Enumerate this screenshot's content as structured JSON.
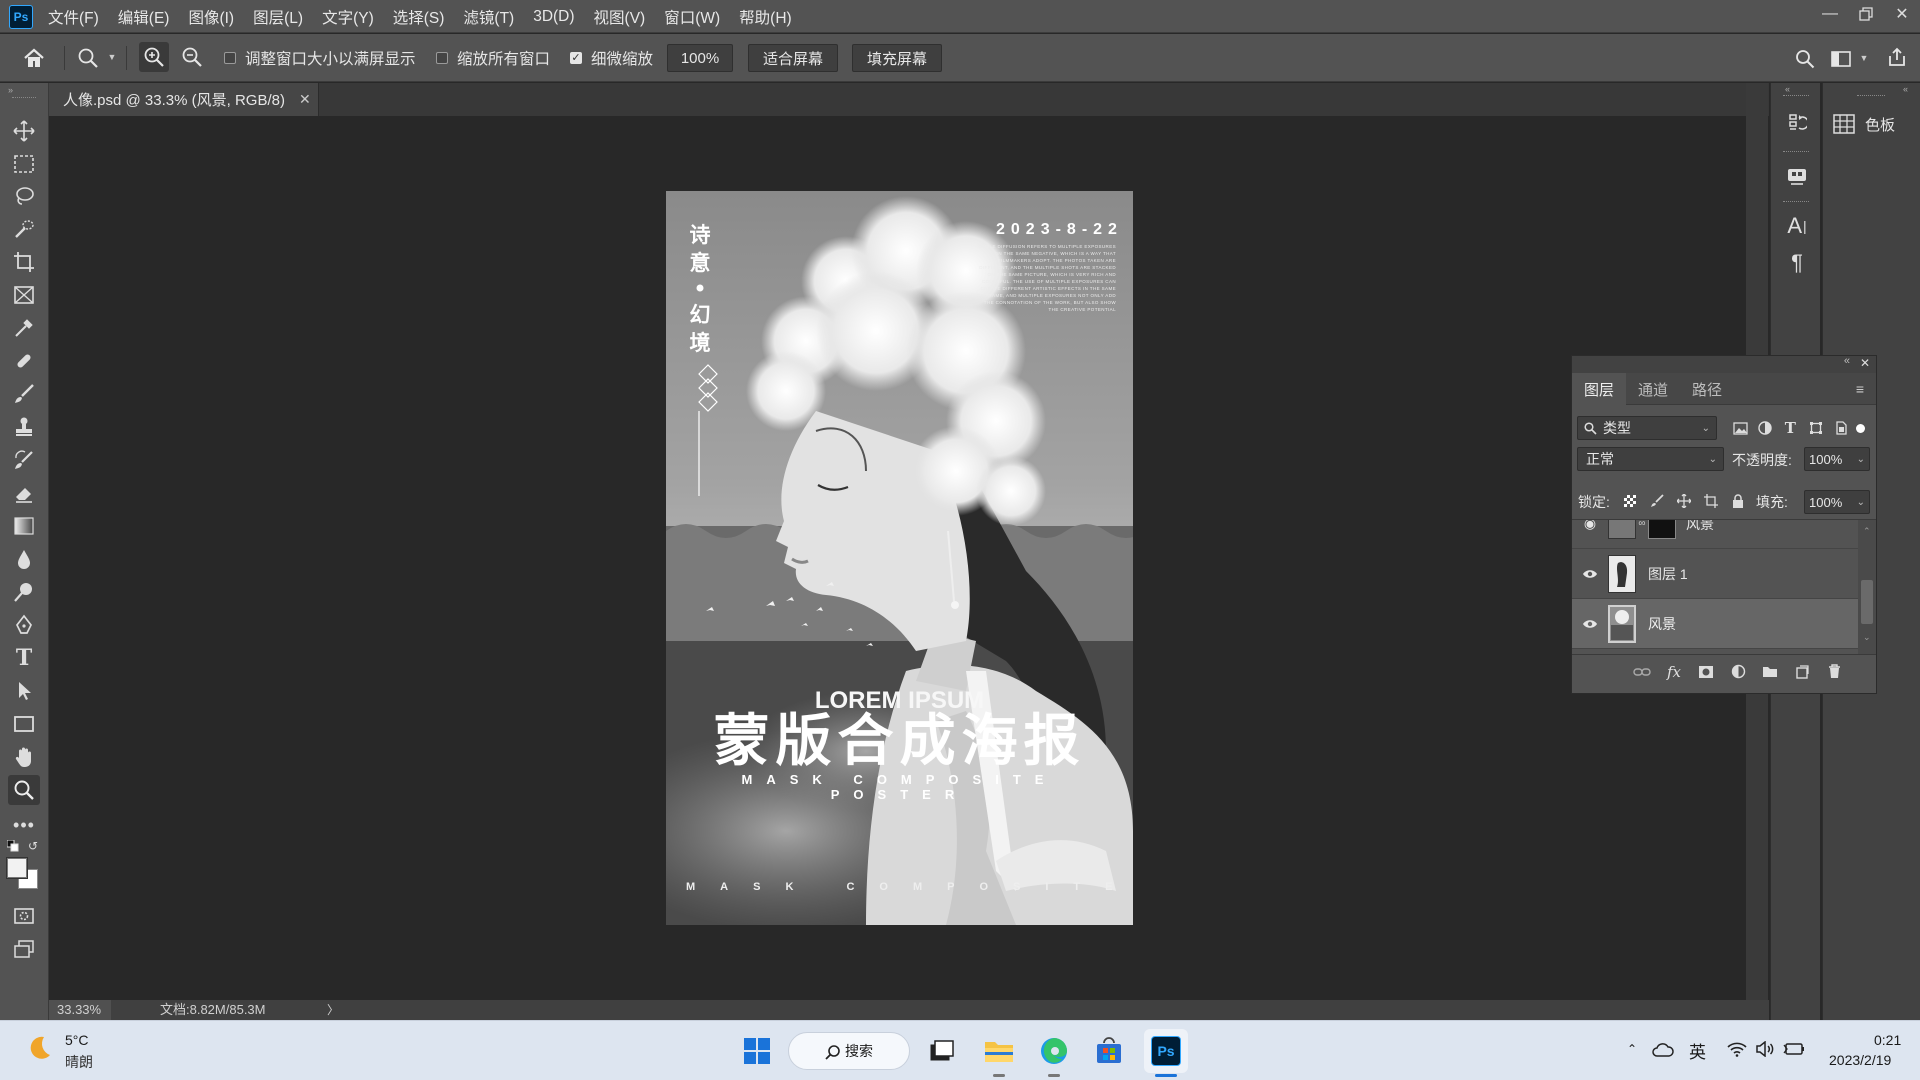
{
  "app": {
    "logo_text": "Ps"
  },
  "menu": [
    "文件(F)",
    "编辑(E)",
    "图像(I)",
    "图层(L)",
    "文字(Y)",
    "选择(S)",
    "滤镜(T)",
    "3D(D)",
    "视图(V)",
    "窗口(W)",
    "帮助(H)"
  ],
  "options": {
    "resize_windows_label": "调整窗口大小以满屏显示",
    "resize_windows_checked": false,
    "zoom_all_label": "缩放所有窗口",
    "zoom_all_checked": false,
    "scrubby_zoom_label": "细微缩放",
    "scrubby_zoom_checked": true,
    "zoom_value": "100%",
    "fit_screen_label": "适合屏幕",
    "fill_screen_label": "填充屏幕"
  },
  "document": {
    "tab_title": "人像.psd @ 33.3% (风景, RGB/8)",
    "status_zoom": "33.33%",
    "status_doc": "文档:8.82M/85.3M",
    "status_arrow": "〉"
  },
  "poster": {
    "date": "2023-8-22",
    "vertical_top": [
      "诗",
      "意"
    ],
    "vertical_bottom": [
      "幻",
      "境"
    ],
    "small_text": "OUBLE DIFFUSION REFERS TO MULTIPLE EXPOSURES ON THE SAME NEGATIVE, WHICH IS A WAY THAT FILMMAKERS ADOPT. THE PHOTOS TAKEN ARE DIFFERENT, AND THE MULTIPLE SHOTS ARE STACKED ON THE SAME PICTURE, WHICH IS VERY RICH AND COLORFUL. THE USE OF MULTIPLE EXPOSURES CAN CREATE DIFFERENT ARTISTIC EFFECTS IN THE SAME FRAME, AND MULTIPLE EXPOSURES NOT ONLY ADD THE CONNOTATION OF THE WORK, BUT ALSO SHOW THE CREATIVE POTENTIAL",
    "lorem": "LOREM IPSUM",
    "main_title": "蒙版合成海报",
    "subtitle": "MASK COMPOSITE POSTER",
    "footer": "MASK COMPOSITE POSTER"
  },
  "dock": {
    "swatches_label": "色板"
  },
  "layers_panel": {
    "tabs": [
      "图层",
      "通道",
      "路径"
    ],
    "active_tab": "图层",
    "filter_kind": "类型",
    "blend_mode": "正常",
    "opacity_label": "不透明度:",
    "opacity_value": "100%",
    "lock_label": "锁定:",
    "fill_label": "填充:",
    "fill_value": "100%",
    "layers": [
      {
        "name": "风景",
        "visible": true,
        "selected": false,
        "has_mask": true
      },
      {
        "name": "图层 1",
        "visible": true,
        "selected": false,
        "has_mask": false
      },
      {
        "name": "风景",
        "visible": true,
        "selected": true,
        "has_mask": false
      }
    ]
  },
  "taskbar": {
    "weather_temp": "5°C",
    "weather_desc": "晴朗",
    "search_label": "搜索",
    "ime_label": "英",
    "time": "0:21",
    "date": "2023/2/19"
  }
}
